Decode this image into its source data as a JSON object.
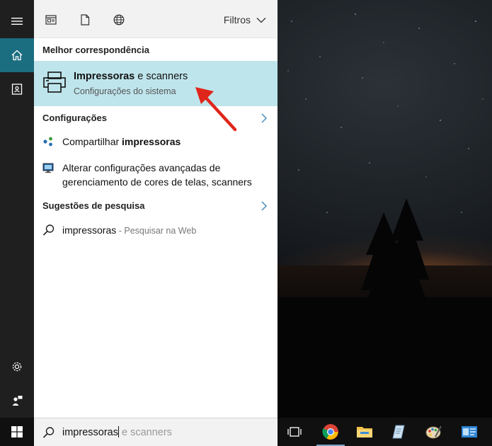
{
  "panel": {
    "filters_label": "Filtros"
  },
  "best_match": {
    "section_label": "Melhor correspondência",
    "title_bold": "Impressoras",
    "title_rest": " e scanners",
    "subtitle": "Configurações do sistema"
  },
  "settings": {
    "section_label": "Configurações",
    "items": [
      {
        "label_plain": "Compartilhar ",
        "label_bold": "impressoras",
        "icon": "network-share-icon"
      },
      {
        "label": "Alterar configurações avançadas de gerenciamento de cores de telas, scanners",
        "icon": "monitor-color-icon"
      }
    ]
  },
  "suggestions": {
    "section_label": "Sugestões de pesquisa",
    "query": "impressoras",
    "suffix": " - Pesquisar na Web"
  },
  "search": {
    "typed": "impressoras",
    "autocomplete": " e scanners"
  },
  "colors": {
    "highlight": "#bfe5ec",
    "sidebar_active": "#1b6d80",
    "arrow": "#e0261b"
  }
}
